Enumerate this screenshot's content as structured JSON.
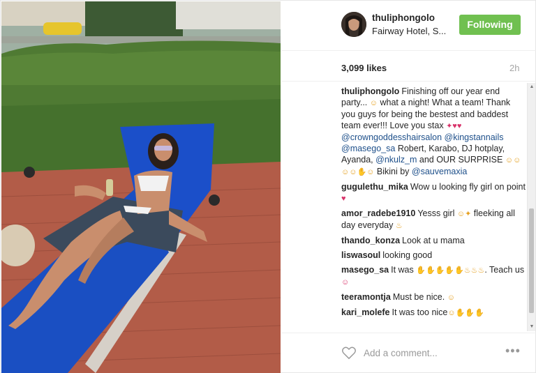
{
  "header": {
    "username": "thuliphongolo",
    "location": "Fairway Hotel, S...",
    "follow_label": "Following"
  },
  "stats": {
    "likes": "3,099 likes",
    "time": "2h"
  },
  "caption": {
    "username": "thuliphongolo",
    "line1": "Finishing off our year end party...",
    "line2": "what a night! What a team! Thank you guys for being the bestest and baddest team ever!!! Love you stax",
    "tag1": "@crowngoddesshairsalon",
    "tag2": "@kingstannails",
    "tag3": "@masego_sa",
    "line3": "Robert, Karabo, DJ hotplay, Ayanda,",
    "tag4": "@nkulz_m",
    "line4": "and OUR SURPRISE",
    "line5": "Bikini by",
    "tag5": "@sauvemaxia"
  },
  "comments": [
    {
      "username": "gugulethu_mika",
      "text": "Wow u looking fly girl on point"
    },
    {
      "username": "amor_radebe1910",
      "text": "Yesss girl",
      "text2": "fleeking all day everyday"
    },
    {
      "username": "thando_konza",
      "text": "Look at u mama"
    },
    {
      "username": "liswasoul",
      "text": "looking good"
    },
    {
      "username": "masego_sa",
      "text": "It was",
      "text2": ". Teach us"
    },
    {
      "username": "teeramontja",
      "text": "Must be nice."
    },
    {
      "username": "kari_molefe",
      "text": "It was too nice"
    }
  ],
  "footer": {
    "add_comment_placeholder": "Add a comment...",
    "more": "•••"
  },
  "colors": {
    "follow_button": "#70c050",
    "link": "#1d4f8a"
  }
}
